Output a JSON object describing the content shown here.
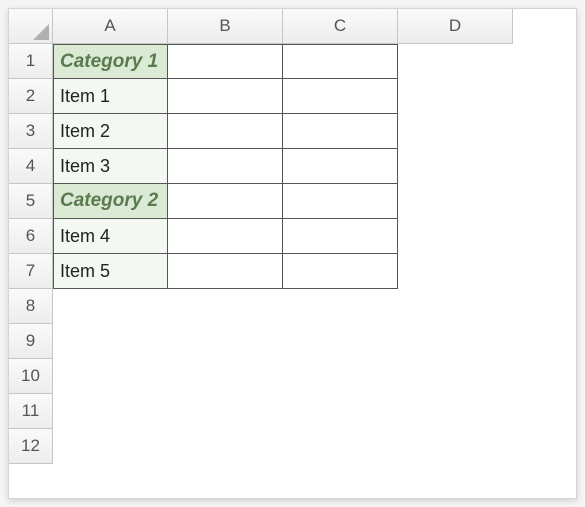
{
  "columns": [
    "A",
    "B",
    "C",
    "D"
  ],
  "rows": [
    "1",
    "2",
    "3",
    "4",
    "5",
    "6",
    "7",
    "8",
    "9",
    "10",
    "11",
    "12"
  ],
  "cells": {
    "A1": "Category 1",
    "A2": "Item 1",
    "A3": "Item 2",
    "A4": "Item 3",
    "A5": "Category 2",
    "A6": "Item 4",
    "A7": "Item 5"
  },
  "categoryRows": [
    1,
    5
  ],
  "borderedRange": {
    "rowStart": 1,
    "rowEnd": 7,
    "colStart": 1,
    "colEnd": 3
  },
  "fillColA": {
    "rowStart": 1,
    "rowEnd": 7
  }
}
